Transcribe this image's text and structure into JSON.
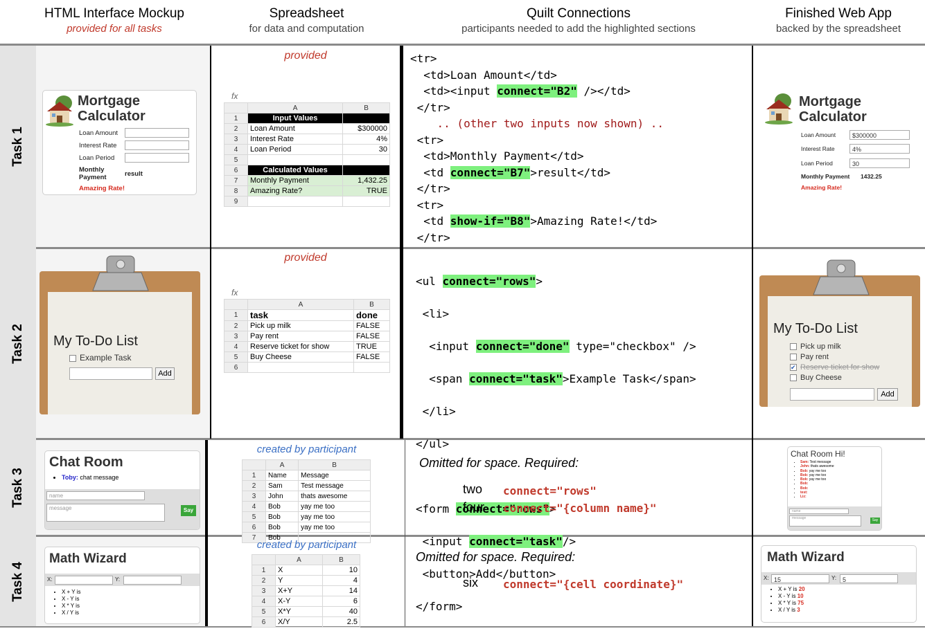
{
  "headers": [
    {
      "title": "HTML Interface Mockup",
      "sub": "provided for all tasks"
    },
    {
      "title": "Spreadsheet",
      "sub": "for data and computation"
    },
    {
      "title": "Quilt Connections",
      "sub": "participants needed to add the highlighted sections"
    },
    {
      "title": "Finished Web App",
      "sub": "backed by the spreadsheet"
    }
  ],
  "tasks": [
    "Task 1",
    "Task 2",
    "Task 3",
    "Task 4"
  ],
  "provided": "provided",
  "created": "created by participant",
  "fx": "fx",
  "task1": {
    "title1": "Mortgage",
    "title2": "Calculator",
    "loan_amount": "Loan Amount",
    "interest_rate": "Interest Rate",
    "loan_period": "Loan Period",
    "monthly_payment": "Monthly Payment",
    "monthly1": "Monthly",
    "monthly2": "Payment",
    "result": "result",
    "amazing": "Amazing Rate!",
    "app_loan": "$300000",
    "app_rate": "4%",
    "app_period": "30",
    "app_result": "1432.25",
    "sheet": {
      "colA": "A",
      "colB": "B",
      "rows": [
        [
          "1",
          "Input Values",
          ""
        ],
        [
          "2",
          "Loan Amount",
          "$300000"
        ],
        [
          "3",
          "Interest Rate",
          "4%"
        ],
        [
          "4",
          "Loan Period",
          "30"
        ],
        [
          "5",
          "",
          ""
        ],
        [
          "6",
          "Calculated Values",
          ""
        ],
        [
          "7",
          "Monthly Payment",
          "1,432.25"
        ],
        [
          "8",
          "Amazing Rate?",
          "TRUE"
        ],
        [
          "9",
          "",
          ""
        ]
      ]
    },
    "code": [
      "<tr>",
      "  <td>Loan Amount</td>",
      "  <td><input ",
      "connect=\"B2\"",
      " /></td>",
      " </tr>",
      "    .. (other two inputs now shown) ..",
      " <tr>",
      "  <td>Monthly Payment</td>",
      "  <td ",
      "connect=\"B7\"",
      ">result</td>",
      " </tr>",
      " <tr>",
      "  <td ",
      "show-if=\"B8\"",
      ">Amazing Rate!</td>",
      " </tr>"
    ]
  },
  "task2": {
    "title": "My To-Do List",
    "example": "Example Task",
    "add": "Add",
    "items": [
      "Pick up milk",
      "Pay rent",
      "Reserve ticket for show",
      "Buy Cheese"
    ],
    "sheet": {
      "colA": "A",
      "colB": "B",
      "rows": [
        [
          "1",
          "task",
          "done"
        ],
        [
          "2",
          "Pick up milk",
          "FALSE"
        ],
        [
          "3",
          "Pay rent",
          "FALSE"
        ],
        [
          "4",
          "Reserve ticket for show",
          "TRUE"
        ],
        [
          "5",
          "Buy Cheese",
          "FALSE"
        ],
        [
          "6",
          "",
          ""
        ]
      ]
    },
    "code": {
      "l1a": "<ul ",
      "l1b": "connect=\"rows\"",
      "l1c": ">",
      "l2": " <li>",
      "l3a": "  <input ",
      "l3b": "connect=\"done\"",
      "l3c": " type=\"checkbox\" />",
      "l4a": "  <span ",
      "l4b": "connect=\"task\"",
      "l4c": ">Example Task</span>",
      "l5": " </li>",
      "l6": "</ul>",
      "l7a": "<form ",
      "l7b": "connect=\"rows\"",
      "l7c": ">",
      "l8a": " <input ",
      "l8b": "connect=\"task\"",
      "l8c": "/>",
      "l9": " <button>Add</button>",
      "l10": "</form>"
    }
  },
  "task3": {
    "title": "Chat Room",
    "app_title": "Chat Room Hi!",
    "toby": "Toby:",
    "toby_msg": " chat message",
    "name_ph": "name",
    "msg_ph": "message",
    "say": "Say",
    "app_msgs": [
      [
        "Sam:",
        "Test message"
      ],
      [
        "John:",
        "thats awesome"
      ],
      [
        "Bob:",
        "yay me too"
      ],
      [
        "Bob:",
        "yay me too"
      ],
      [
        "Bob:",
        "yay me too"
      ],
      [
        "Bob:",
        ""
      ],
      [
        "Bob:",
        ""
      ],
      [
        "test:",
        ""
      ],
      [
        "Liz:",
        ""
      ]
    ],
    "sheet": {
      "colA": "A",
      "colB": "B",
      "rows": [
        [
          "1",
          "Name",
          "Message"
        ],
        [
          "2",
          "Sam",
          "Test message"
        ],
        [
          "3",
          "John",
          "thats awesome"
        ],
        [
          "4",
          "Bob",
          "yay me too"
        ],
        [
          "5",
          "Bob",
          "yay me too"
        ],
        [
          "6",
          "Bob",
          "yay me too"
        ],
        [
          "7",
          "Bob",
          ""
        ]
      ]
    },
    "omitted": "Omitted for space. Required:",
    "req": [
      [
        "two",
        "connect=\"rows\""
      ],
      [
        "four",
        "connect=\"{column name}\""
      ]
    ]
  },
  "task4": {
    "title": "Math Wizard",
    "x": "X:",
    "y": "Y:",
    "lines": [
      "X + Y is",
      "X - Y is",
      "X * Y is",
      "X / Y is"
    ],
    "app_x": "15",
    "app_y": "5",
    "app_vals": [
      "20",
      "10",
      "75",
      "3"
    ],
    "sheet": {
      "colA": "A",
      "colB": "B",
      "rows": [
        [
          "1",
          "X",
          "10"
        ],
        [
          "2",
          "Y",
          "4"
        ],
        [
          "3",
          "X+Y",
          "14"
        ],
        [
          "4",
          "X-Y",
          "6"
        ],
        [
          "5",
          "X*Y",
          "40"
        ],
        [
          "6",
          "X/Y",
          "2.5"
        ]
      ]
    },
    "omitted": "Omitted for space. Required:",
    "req": [
      [
        "six",
        "connect=\"{cell coordinate}\""
      ]
    ]
  }
}
